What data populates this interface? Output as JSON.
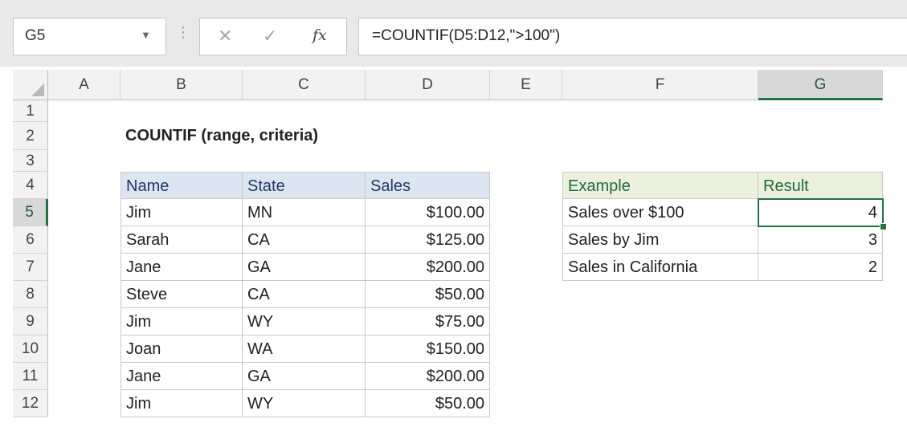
{
  "formula_bar": {
    "name_box": "G5",
    "cancel_icon": "cancel-x-icon",
    "enter_icon": "enter-check-icon",
    "function_icon": "fx-icon",
    "formula": "=COUNTIF(D5:D12,\">100\")"
  },
  "columns": [
    "A",
    "B",
    "C",
    "D",
    "E",
    "F",
    "G"
  ],
  "rows": [
    "1",
    "2",
    "3",
    "4",
    "5",
    "6",
    "7",
    "8",
    "9",
    "10",
    "11",
    "12"
  ],
  "selected_cell": "G5",
  "sheet_title": "COUNTIF (range, criteria)",
  "data_table": {
    "headers": [
      "Name",
      "State",
      "Sales"
    ],
    "rows": [
      [
        "Jim",
        "MN",
        "$100.00"
      ],
      [
        "Sarah",
        "CA",
        "$125.00"
      ],
      [
        "Jane",
        "GA",
        "$200.00"
      ],
      [
        "Steve",
        "CA",
        "$50.00"
      ],
      [
        "Jim",
        "WY",
        "$75.00"
      ],
      [
        "Joan",
        "WA",
        "$150.00"
      ],
      [
        "Jane",
        "GA",
        "$200.00"
      ],
      [
        "Jim",
        "WY",
        "$50.00"
      ]
    ]
  },
  "example_table": {
    "headers": [
      "Example",
      "Result"
    ],
    "rows": [
      [
        "Sales over $100",
        "4"
      ],
      [
        "Sales by Jim",
        "3"
      ],
      [
        "Sales in California",
        "2"
      ]
    ]
  },
  "colors": {
    "selection_green": "#217346",
    "data_header_fill": "#dce6f1",
    "example_header_fill": "#ebf1de",
    "data_header_text": "#1f3864",
    "example_header_text": "#1f6a3a"
  }
}
